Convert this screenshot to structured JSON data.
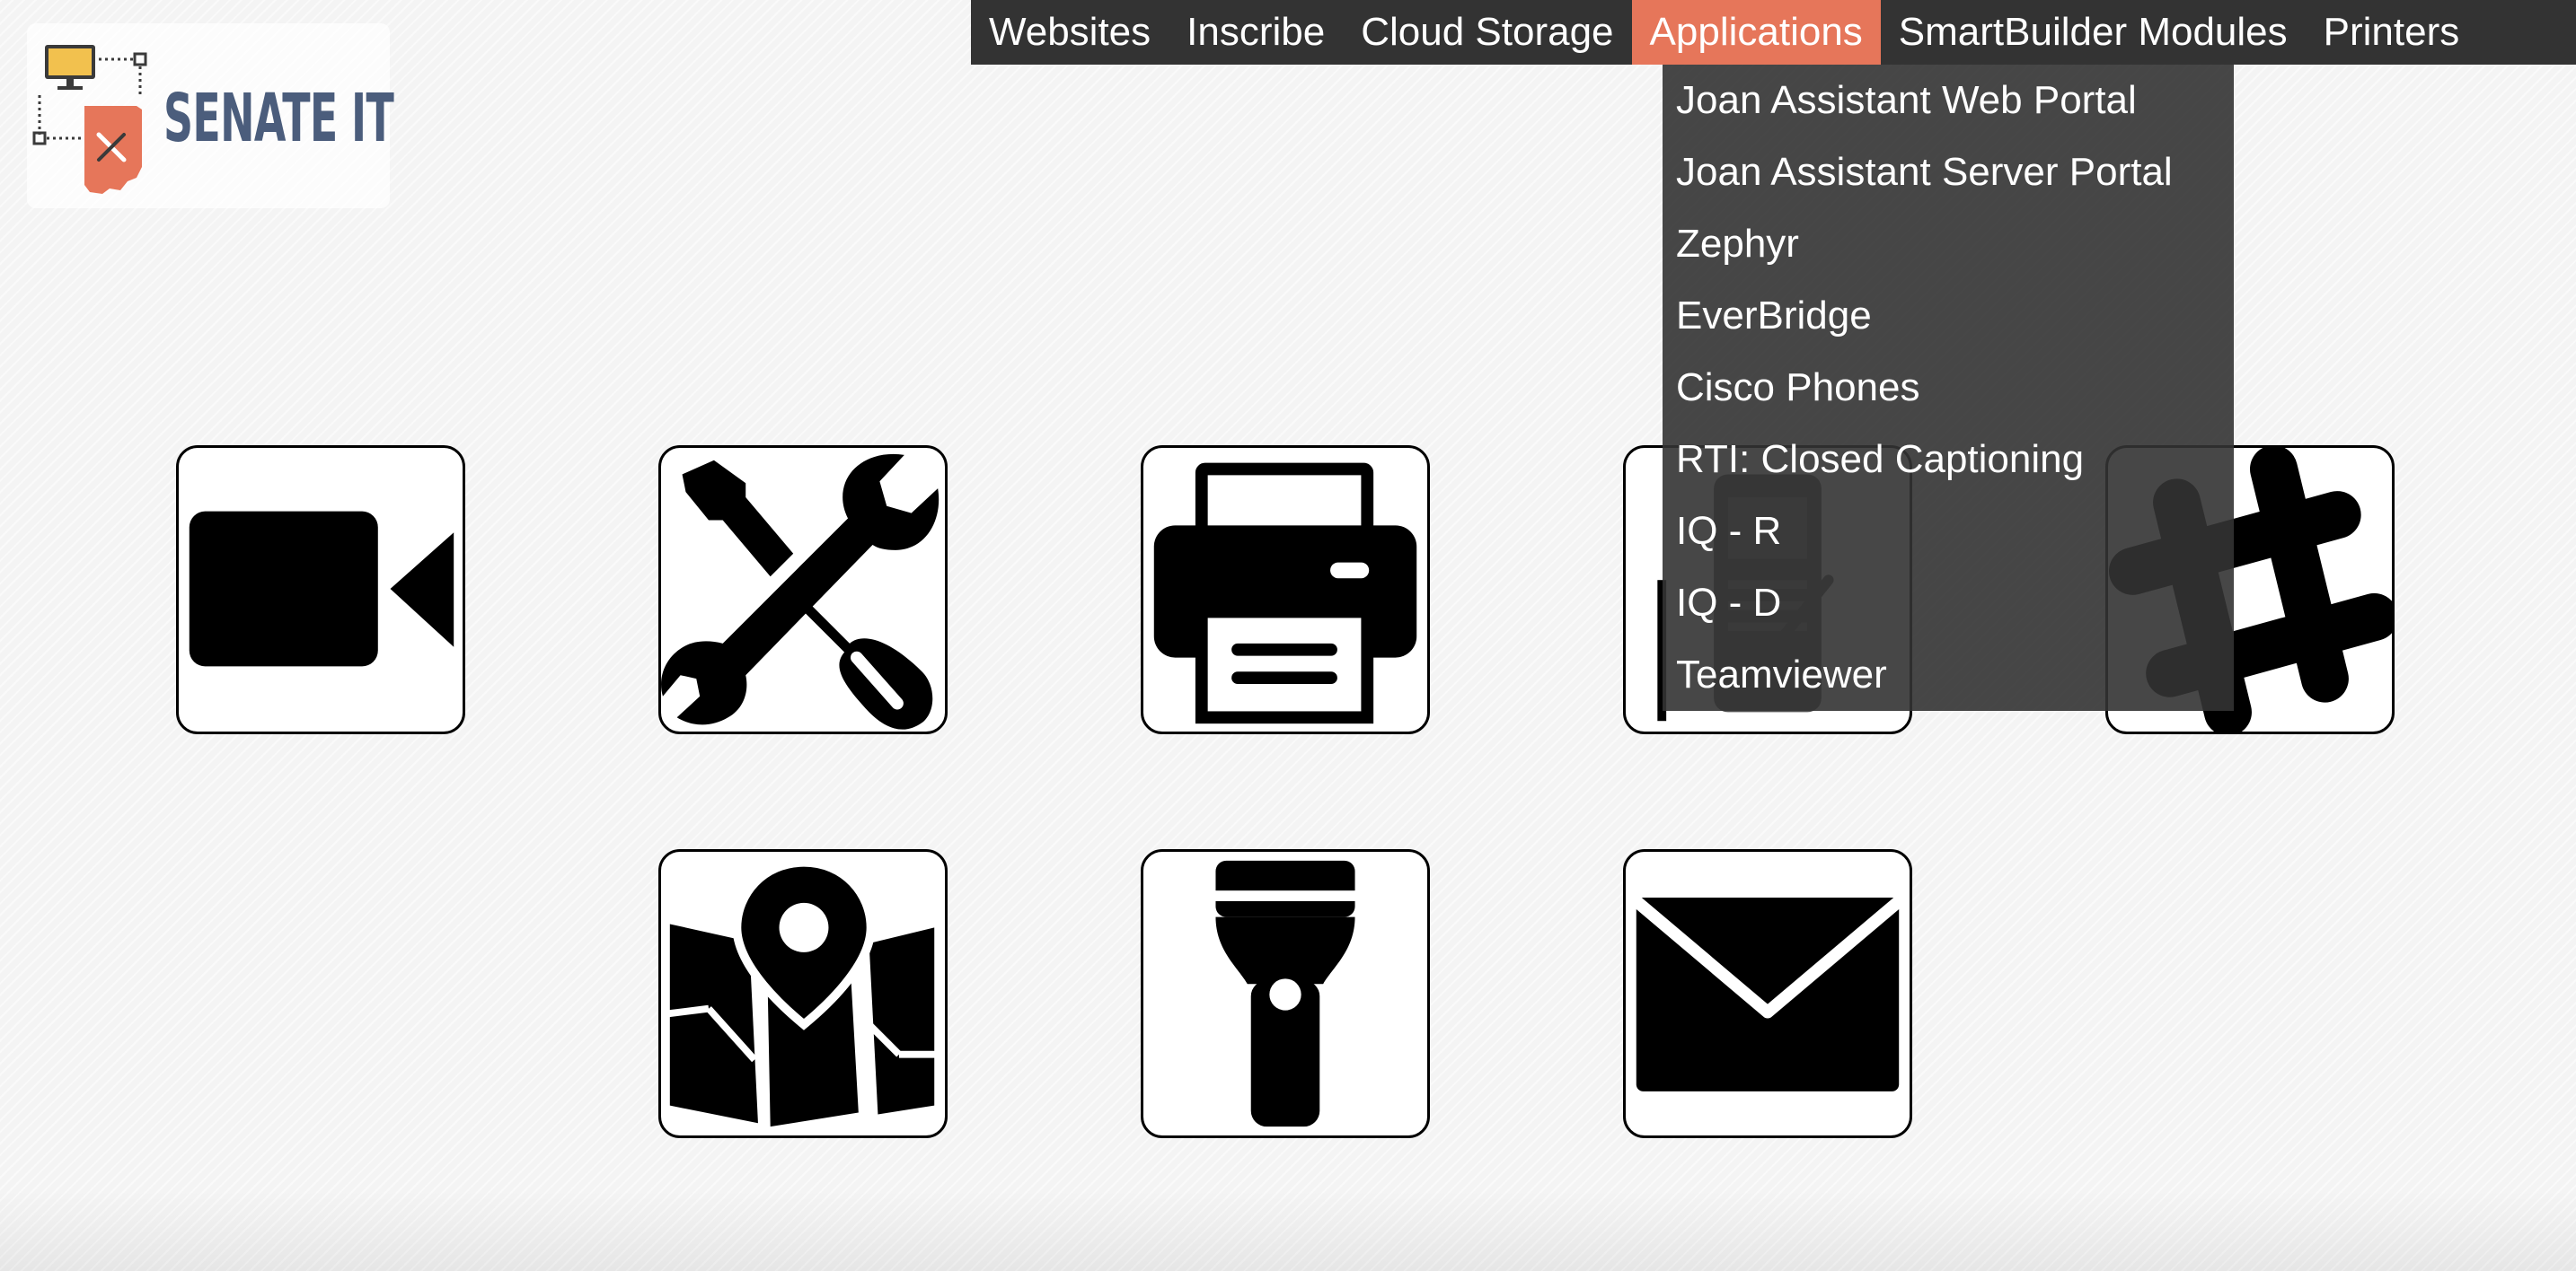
{
  "logo": {
    "text": "SENATE IT"
  },
  "nav": {
    "items": [
      {
        "label": "Websites"
      },
      {
        "label": "Inscribe"
      },
      {
        "label": "Cloud Storage"
      },
      {
        "label": "Applications"
      },
      {
        "label": "SmartBuilder Modules"
      },
      {
        "label": "Printers"
      }
    ],
    "active": "Applications",
    "bar_color": "#333333",
    "active_color": "#e6765a"
  },
  "applications_menu": {
    "items": [
      {
        "label": "Joan Assistant Web Portal"
      },
      {
        "label": "Joan Assistant Server Portal"
      },
      {
        "label": "Zephyr"
      },
      {
        "label": "EverBridge"
      },
      {
        "label": "Cisco Phones"
      },
      {
        "label": "RTI: Closed Captioning"
      },
      {
        "label": "IQ - R"
      },
      {
        "label": "IQ - D"
      },
      {
        "label": "Teamviewer"
      }
    ]
  },
  "tiles": [
    {
      "icon": "video-camera-icon"
    },
    {
      "icon": "tools-icon"
    },
    {
      "icon": "printer-icon"
    },
    {
      "icon": "phone-icon"
    },
    {
      "icon": "slack-hash-icon"
    },
    {
      "icon": "map-icon"
    },
    {
      "icon": "flashlight-icon"
    },
    {
      "icon": "envelope-icon"
    }
  ]
}
